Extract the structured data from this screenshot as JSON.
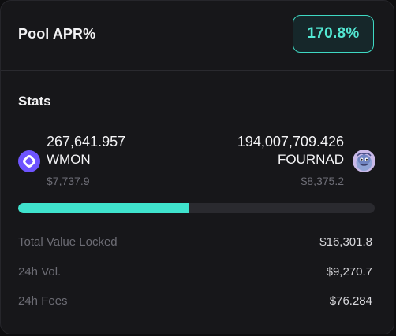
{
  "pool": {
    "apr_title": "Pool APR%",
    "apr_value": "170.8%",
    "accent_color": "#3fe3cd"
  },
  "stats": {
    "title": "Stats",
    "left_token": {
      "amount": "267,641.957",
      "symbol": "WMON",
      "usd": "$7,737.9",
      "icon": "wmon-token-icon"
    },
    "right_token": {
      "amount": "194,007,709.426",
      "symbol": "FOURNAD",
      "usd": "$8,375.2",
      "icon": "fournad-token-icon"
    },
    "ratio_bar": {
      "left_fraction": 0.48
    },
    "metrics": [
      {
        "label": "Total Value Locked",
        "value": "$16,301.8"
      },
      {
        "label": "24h Vol.",
        "value": "$9,270.7"
      },
      {
        "label": "24h Fees",
        "value": "$76.284"
      }
    ]
  }
}
